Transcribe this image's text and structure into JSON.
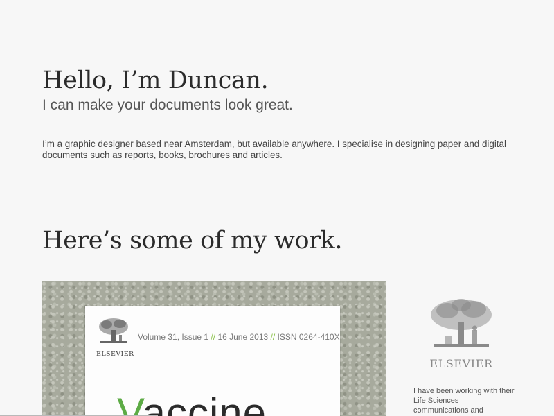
{
  "hero": {
    "greeting": "Hello, I’m Duncan.",
    "tagline": "I can make your documents look great.",
    "intro": "I’m a graphic designer based near Amsterdam, but available anywhere. I specialise in designing paper and digital documents such as reports, books, brochures and articles."
  },
  "work": {
    "heading": "Here’s some of my work.",
    "cover": {
      "publisher_logo_text": "ELSEVIER",
      "issue_volume": "Volume 31, Issue 1",
      "issue_separator": "//",
      "issue_date": "16 June 2013",
      "issue_issn": "ISSN 0264-410X",
      "title_first_letter": "V",
      "title_rest": "accine"
    },
    "client": {
      "logo_text": "ELSEVIER",
      "description": "I have been working with their Life Sciences communications and"
    }
  },
  "colors": {
    "background": "#f7f7f7",
    "accent_green": "#5dab45",
    "heading_text": "#2b2b2b"
  }
}
